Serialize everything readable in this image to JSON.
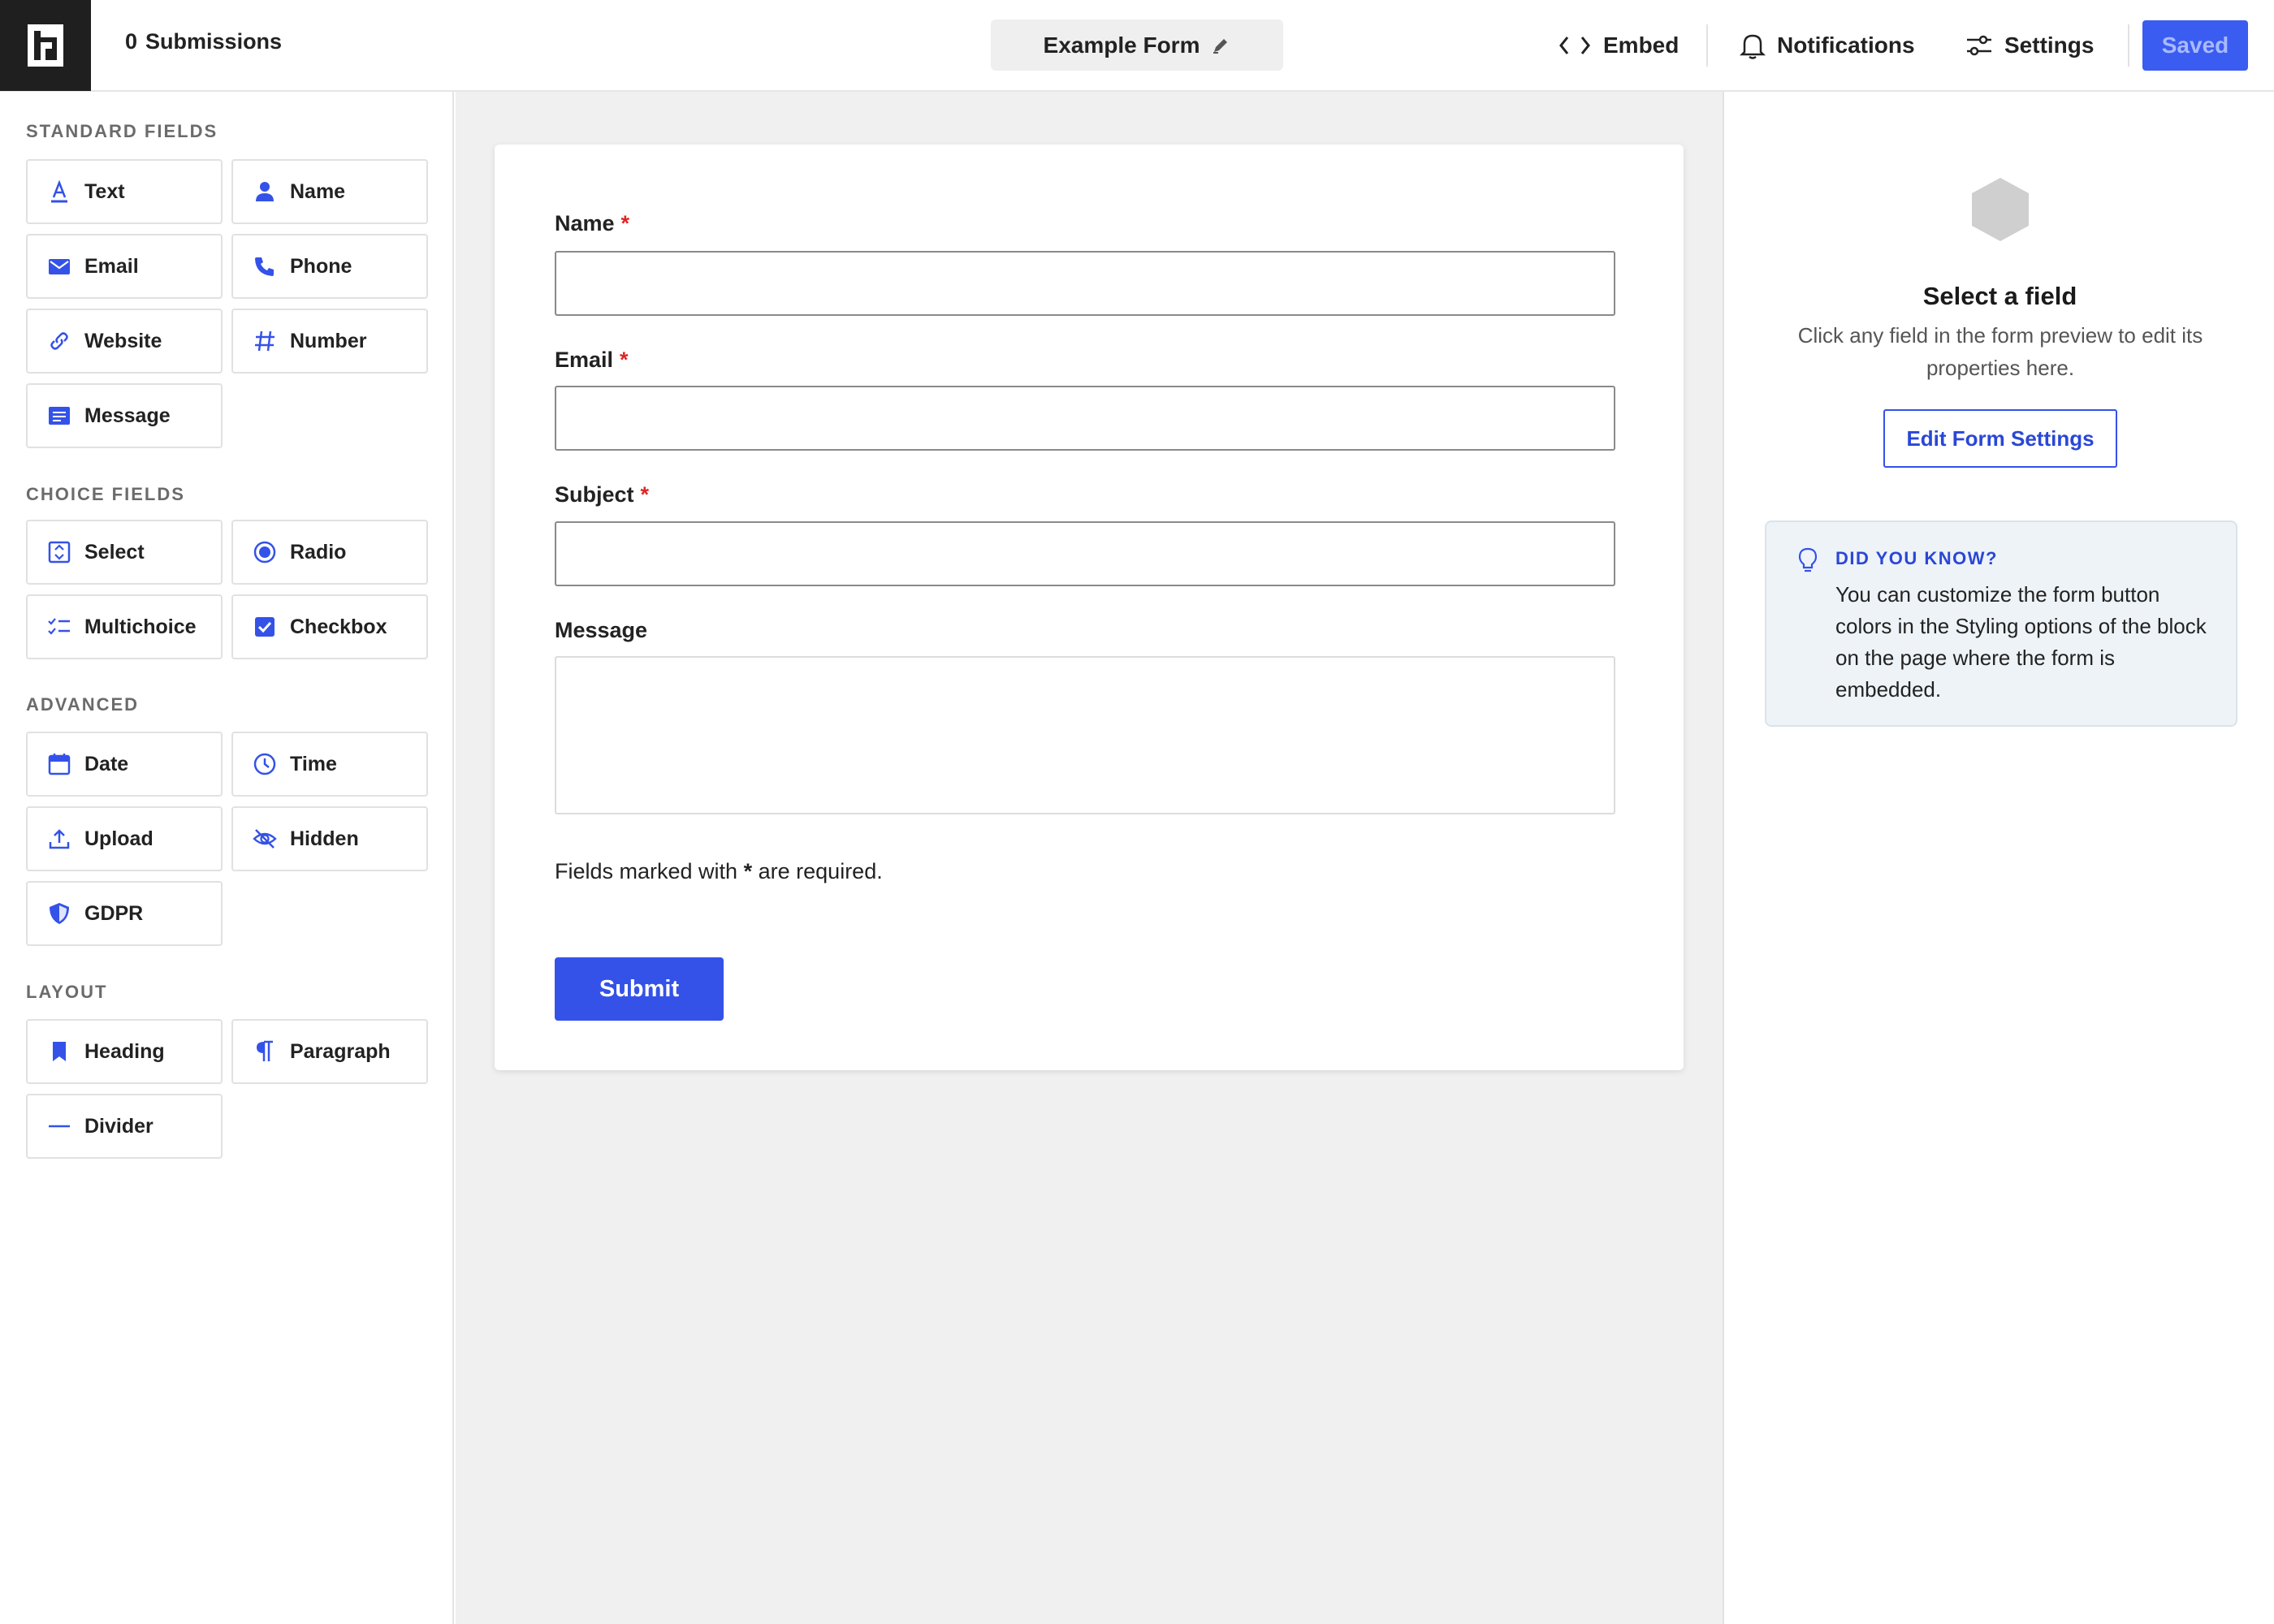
{
  "header": {
    "submissions_count": "0",
    "submissions_label": "Submissions",
    "form_title": "Example Form",
    "embed_label": "Embed",
    "notifications_label": "Notifications",
    "settings_label": "Settings",
    "saved_label": "Saved"
  },
  "sidebar": {
    "standard_title": "STANDARD FIELDS",
    "standard": [
      {
        "label": "Text",
        "icon": "text-icon"
      },
      {
        "label": "Name",
        "icon": "person-icon"
      },
      {
        "label": "Email",
        "icon": "envelope-icon"
      },
      {
        "label": "Phone",
        "icon": "phone-icon"
      },
      {
        "label": "Website",
        "icon": "link-icon"
      },
      {
        "label": "Number",
        "icon": "hash-icon"
      },
      {
        "label": "Message",
        "icon": "message-icon"
      }
    ],
    "choice_title": "CHOICE FIELDS",
    "choice": [
      {
        "label": "Select",
        "icon": "select-icon"
      },
      {
        "label": "Radio",
        "icon": "radio-icon"
      },
      {
        "label": "Multichoice",
        "icon": "checklist-icon"
      },
      {
        "label": "Checkbox",
        "icon": "checkbox-icon"
      }
    ],
    "advanced_title": "ADVANCED",
    "advanced": [
      {
        "label": "Date",
        "icon": "calendar-icon"
      },
      {
        "label": "Time",
        "icon": "clock-icon"
      },
      {
        "label": "Upload",
        "icon": "upload-icon"
      },
      {
        "label": "Hidden",
        "icon": "eye-off-icon"
      },
      {
        "label": "GDPR",
        "icon": "shield-icon"
      }
    ],
    "layout_title": "LAYOUT",
    "layout": [
      {
        "label": "Heading",
        "icon": "bookmark-icon"
      },
      {
        "label": "Paragraph",
        "icon": "pilcrow-icon"
      },
      {
        "label": "Divider",
        "icon": "divider-icon"
      }
    ]
  },
  "form": {
    "fields": [
      {
        "label": "Name",
        "required": "*",
        "value": ""
      },
      {
        "label": "Email",
        "required": "*",
        "value": ""
      },
      {
        "label": "Subject",
        "required": "*",
        "value": ""
      },
      {
        "label": "Message",
        "required": "",
        "value": ""
      }
    ],
    "note_prefix": "Fields marked with",
    "note_mark": "*",
    "note_suffix": "are required.",
    "submit_label": "Submit"
  },
  "right_panel": {
    "title": "Select a field",
    "description": "Click any field in the form preview to edit its properties here.",
    "edit_button": "Edit Form Settings",
    "tip_title": "DID YOU KNOW?",
    "tip_text": "You can customize the form button colors in the Styling options of the block on the page where the form is embedded."
  },
  "colors": {
    "accent": "#3452e8",
    "required": "#e02424",
    "logo_bg": "#1f1f1f"
  }
}
